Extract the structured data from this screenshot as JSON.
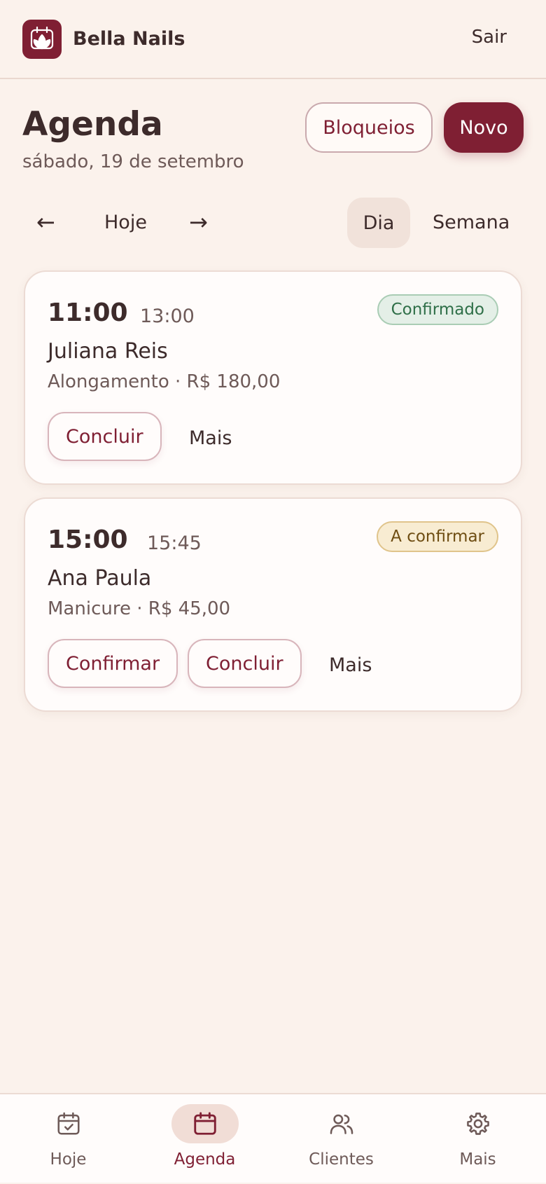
{
  "header": {
    "brand_name": "Bella Nails",
    "logout_label": "Sair"
  },
  "page": {
    "title": "Agenda",
    "date": "sábado, 19 de setembro",
    "blocks_label": "Bloqueios",
    "new_label": "Novo"
  },
  "nav": {
    "prev": "←",
    "today_label": "Hoje",
    "next": "→",
    "view_day": "Dia",
    "view_week": "Semana",
    "active_view": "Dia"
  },
  "appointments": [
    {
      "start": "11:00",
      "end": "13:00",
      "status": "Confirmado",
      "client": "Juliana Reis",
      "service": "Alongamento · R$ 180,00",
      "actions": [
        "Concluir"
      ],
      "more_label": "Mais"
    },
    {
      "start": "15:00",
      "end": "15:45",
      "status": "A confirmar",
      "client": "Ana Paula",
      "service": "Manicure · R$ 45,00",
      "actions": [
        "Confirmar",
        "Concluir"
      ],
      "more_label": "Mais"
    }
  ],
  "bottom_nav": {
    "items": [
      {
        "label": "Hoje",
        "icon": "calendar-check-icon"
      },
      {
        "label": "Agenda",
        "icon": "calendar-icon"
      },
      {
        "label": "Clientes",
        "icon": "users-icon"
      },
      {
        "label": "Mais",
        "icon": "gear-icon"
      }
    ],
    "active": "Agenda"
  },
  "colors": {
    "brand": "#7f1f33",
    "background": "#fbf2ec",
    "confirmed": "#2f6f48",
    "pending": "#6e4d12"
  }
}
